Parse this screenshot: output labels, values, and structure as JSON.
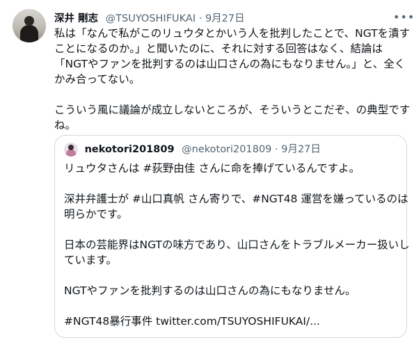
{
  "tweet": {
    "author_name": "深井 剛志",
    "author_handle": "@TSUYOSHIFUKAI",
    "separator": "·",
    "date": "9月27日",
    "more_label": "•••",
    "lines": [
      "私は「なんで私がこのリュウタとかいう人を批判したことで、NGTを潰す",
      "ことになるのか。」と聞いたのに、それに対する回答はなく、結論は",
      "「NGTやファンを批判するのは山口さんの為にもなりません。」と、全く",
      "かみ合ってない。",
      "",
      "こういう風に議論が成立しないところが、そういうとこだぞ、の典型です",
      "ね。"
    ]
  },
  "quoted_tweet": {
    "author_name": "nekotori201809",
    "author_handle": "@nekotori201809",
    "separator": "·",
    "date": "9月27日",
    "lines": [
      "リュウタさんは #荻野由佳 さんに命を捧げているんですよ。",
      "",
      "深井弁護士が #山口真帆 さん寄りで、#NGT48 運営を嫌っているのは",
      "明らかです。",
      "",
      "日本の芸能界はNGTの味方であり、山口さんをトラブルメーカー扱いし",
      "ています。",
      "",
      "NGTやファンを批判するのは山口さんの為にもなりません。",
      "",
      "#NGT48暴行事件  twitter.com/TSUYOSHIFUKAI/..."
    ]
  }
}
